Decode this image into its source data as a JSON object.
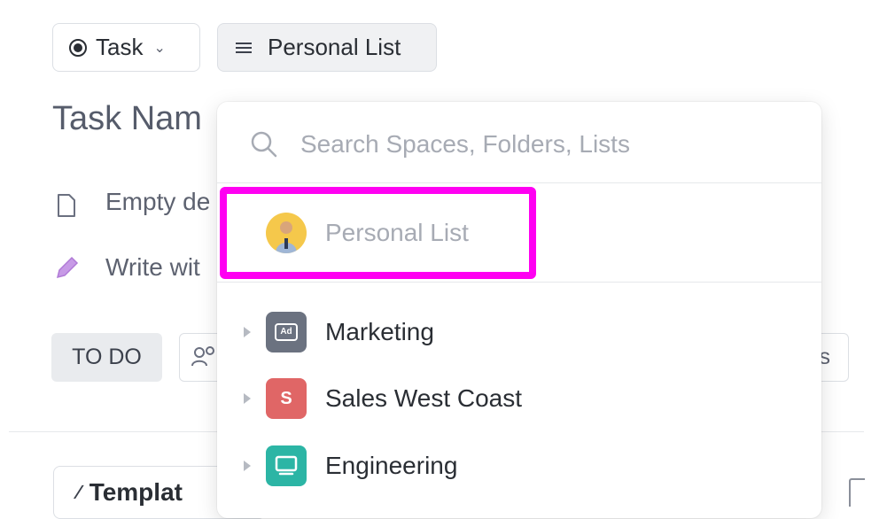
{
  "header": {
    "task_type_label": "Task",
    "list_label": "Personal List"
  },
  "task": {
    "title_partial": "Task Nam",
    "empty_desc_partial": "Empty de",
    "write_ai_partial": "Write wit",
    "status": "TO DO",
    "right_chip_partial": "s",
    "template_partial": "Templat"
  },
  "dropdown": {
    "search_placeholder": "Search Spaces, Folders, Lists",
    "personal_item": "Personal List",
    "spaces": [
      {
        "name": "Marketing",
        "icon": "ad-icon",
        "color": "#6b7280",
        "badge": "Ad"
      },
      {
        "name": "Sales West Coast",
        "icon": "letter-s-icon",
        "color": "#e06666",
        "badge": "S"
      },
      {
        "name": "Engineering",
        "icon": "monitor-icon",
        "color": "#2cb5a5",
        "badge": ""
      }
    ]
  },
  "colors": {
    "highlight": "#ff00f2",
    "accent_purple": "#b07ad6"
  }
}
